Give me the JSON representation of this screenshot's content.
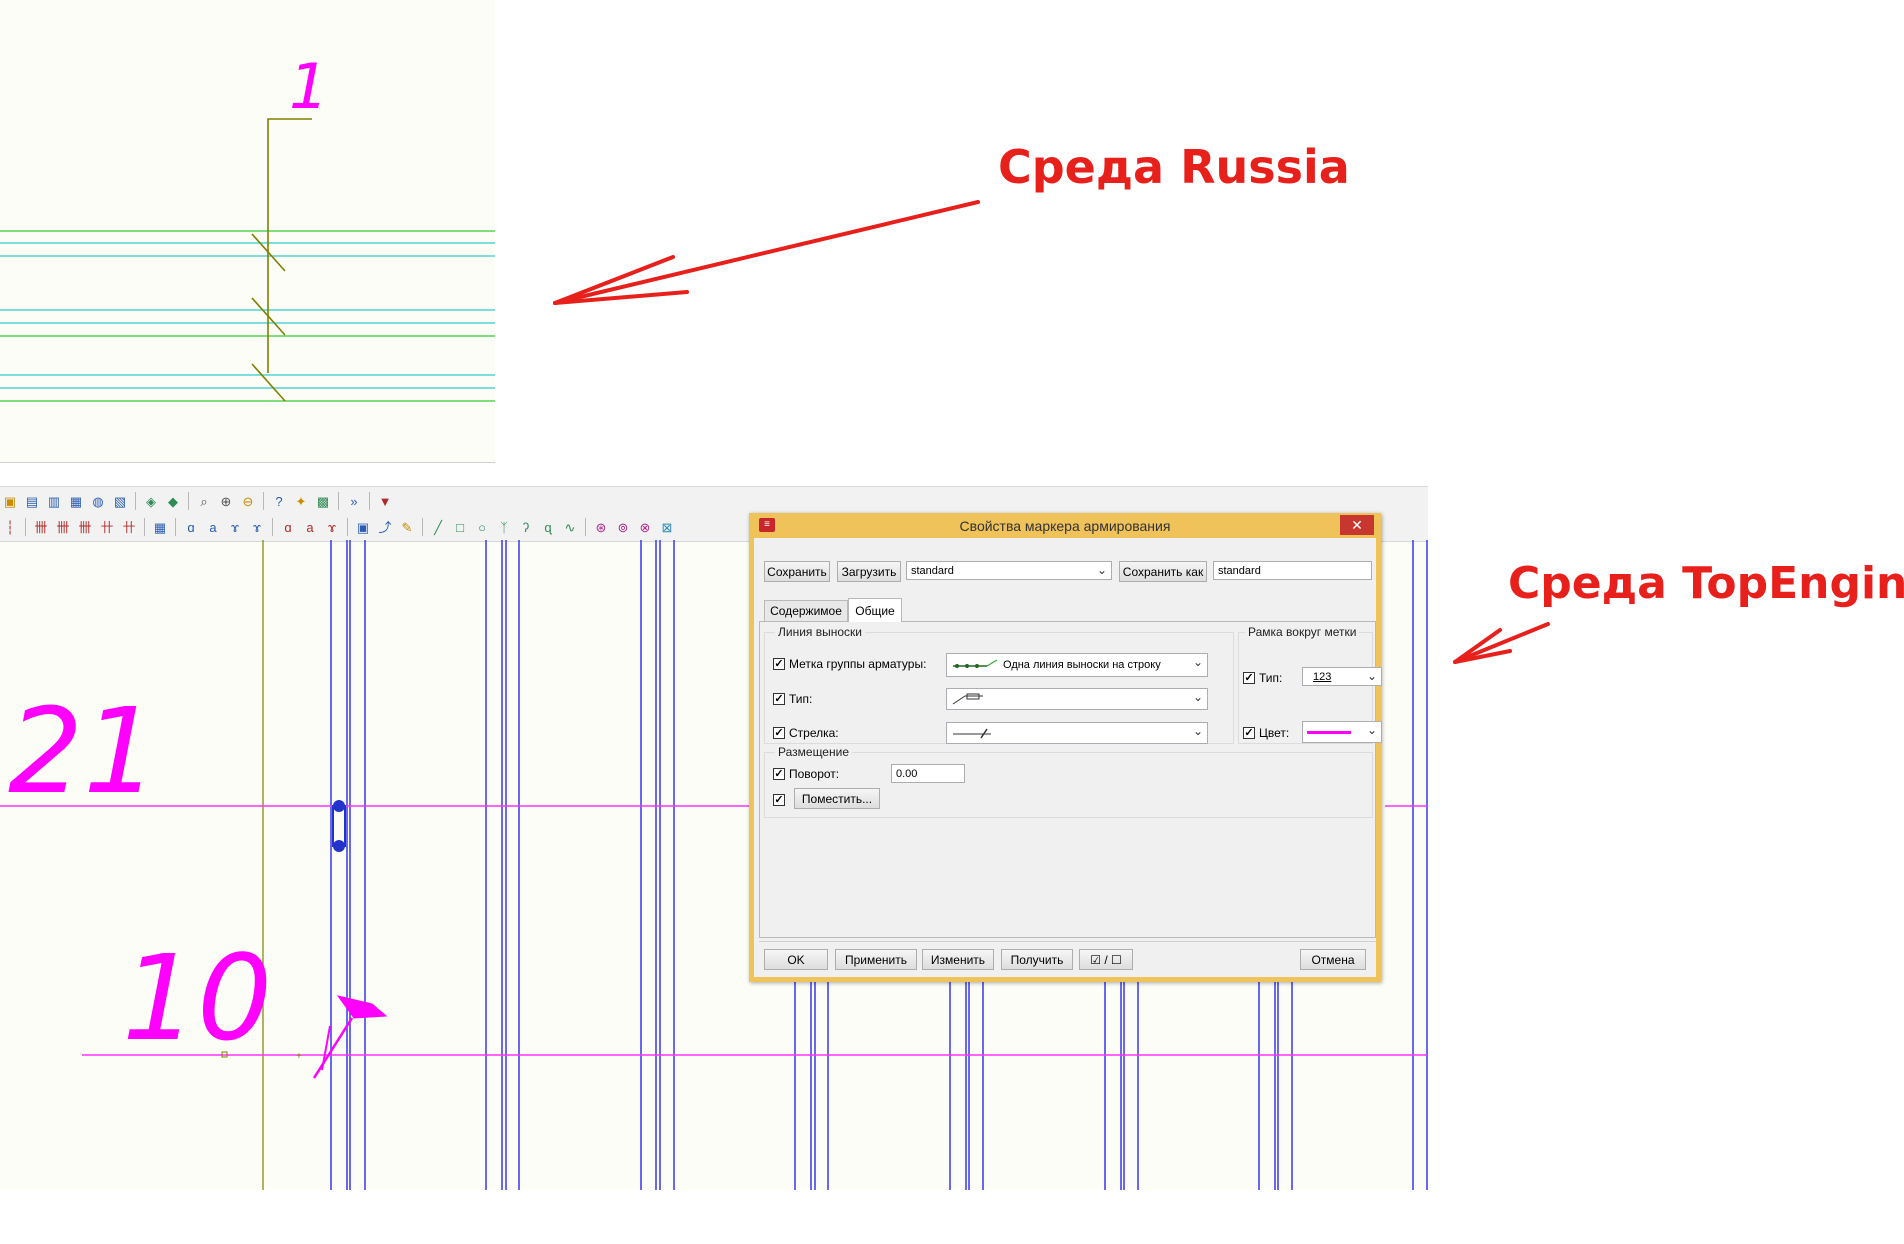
{
  "annotations": {
    "russia_env": "Среда Russia",
    "topengineer_env": "Среда TopEngineer"
  },
  "cad_top": {
    "mark_number": "1"
  },
  "cad_bottom": {
    "mark_21": "21",
    "mark_10": "10"
  },
  "toolbar": {
    "row1_icons": [
      "open-icon",
      "save-icon",
      "save-as-icon",
      "print-icon",
      "publish-icon",
      "export-icon",
      "layer-icon",
      "layer-props-icon",
      "zoom-window-icon",
      "zoom-in-icon",
      "zoom-out-icon",
      "help-icon",
      "bookmark-icon",
      "folder-icon",
      "sheet-icon",
      "more-icon",
      "style-icon"
    ],
    "row2_icons": [
      "rebar-a-icon",
      "rebar-b-icon",
      "rebar-c-icon",
      "rebar-d-icon",
      "rebar-e-icon",
      "rebar-f-icon",
      "grid-icon",
      "dim-a-icon",
      "dim-b-icon",
      "dim-c-icon",
      "dim-d-icon",
      "tag-a-icon",
      "tag-b-icon",
      "tag-c-icon",
      "block-icon",
      "insert-icon",
      "pen-icon",
      "line-icon",
      "rect-icon",
      "circle-icon",
      "tree-icon",
      "hook-a-icon",
      "hook-b-icon",
      "spline-icon",
      "snap-a-icon",
      "snap-b-icon",
      "snap-c-icon",
      "snap-d-icon"
    ]
  },
  "dialog": {
    "title": "Свойства маркера армирования",
    "save_label": "Сохранить",
    "load_label": "Загрузить",
    "style_value": "standard",
    "save_as_label": "Сохранить как",
    "save_as_value": "standard",
    "tabs": [
      "Содержимое",
      "Общие"
    ],
    "active_tab": "Общие",
    "leader_group": "Линия выноски",
    "rebar_group_mark_label": "Метка группы арматуры:",
    "rebar_group_mark_value": "Одна линия выноски на строку",
    "type_label": "Тип:",
    "arrow_label": "Стрелка:",
    "frame_group": "Рамка вокруг метки",
    "frame_type_label": "Тип:",
    "frame_type_value": "123",
    "frame_color_label": "Цвет:",
    "frame_color": "#ff00ff",
    "placement_group": "Размещение",
    "rotation_label": "Поворот:",
    "rotation_value": "0.00",
    "place_label": "Поместить...",
    "ok_label": "OK",
    "apply_label": "Применить",
    "change_label": "Изменить",
    "get_label": "Получить",
    "toggle_label": "☑ / ☐",
    "cancel_label": "Отмена",
    "close_glyph": "✕"
  },
  "colors": {
    "annotation_red": "#e8201c",
    "dialog_border": "#f0c25a",
    "magenta": "#ff00ff",
    "rebar_blue": "#3333ff"
  }
}
